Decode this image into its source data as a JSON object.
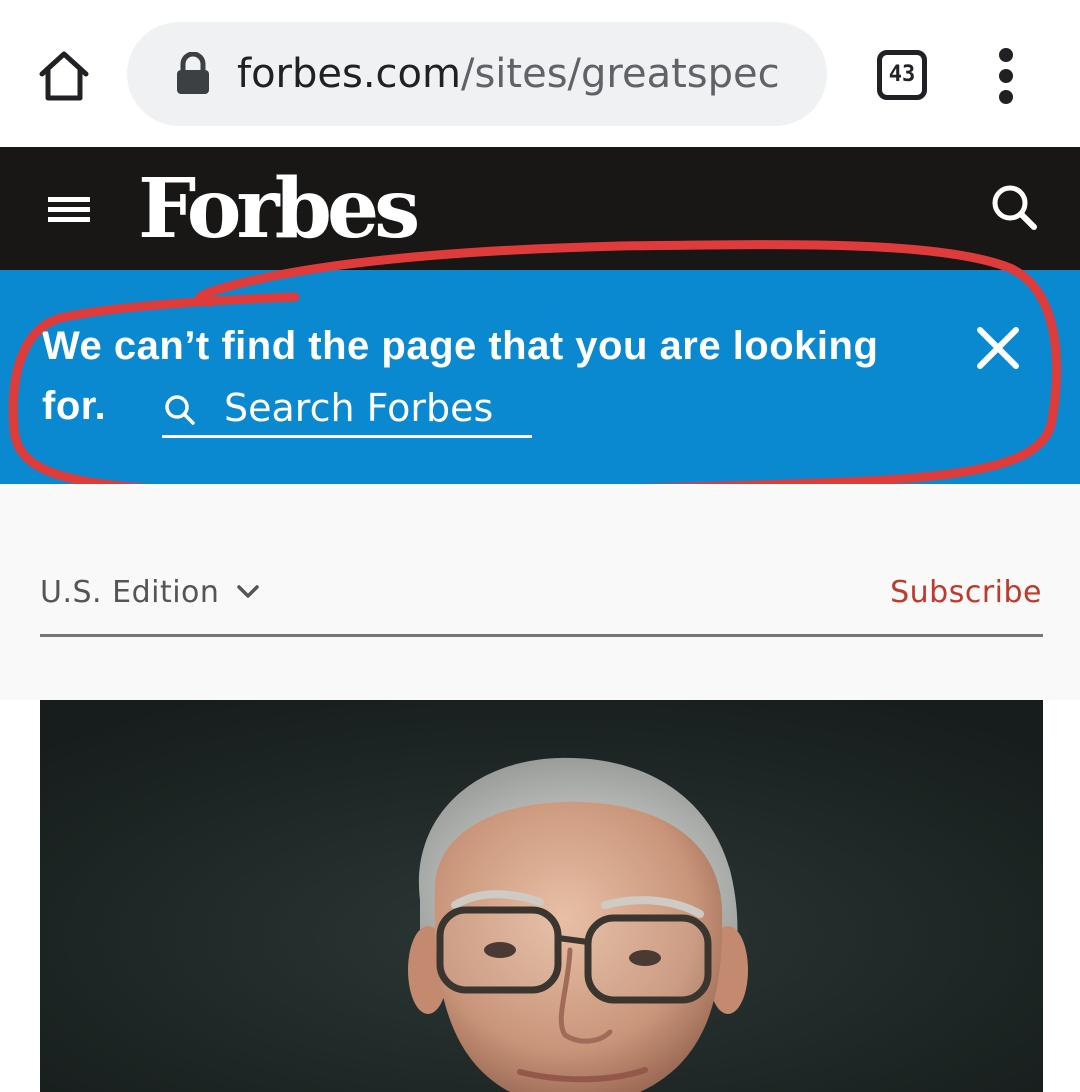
{
  "browser": {
    "url_host": "forbes.com",
    "url_path": "/sites/greatspec",
    "tab_count": "43",
    "icons": [
      "home-icon",
      "lock-icon",
      "tab-switcher-icon",
      "more-vert-icon"
    ]
  },
  "header": {
    "logo_text": "Forbes",
    "icons": [
      "hamburger-menu-icon",
      "search-icon"
    ]
  },
  "banner": {
    "message": "We can’t find the page that you are looking for.",
    "search_label": "Search Forbes",
    "icons": [
      "search-icon",
      "close-icon"
    ],
    "background_color": "#0a88d0",
    "annotation_color": "#e03b3b"
  },
  "edition_bar": {
    "edition_label": "U.S. Edition",
    "subscribe_label": "Subscribe",
    "subscribe_color": "#c0392b"
  },
  "hero": {
    "alt": "photo-portrait"
  }
}
